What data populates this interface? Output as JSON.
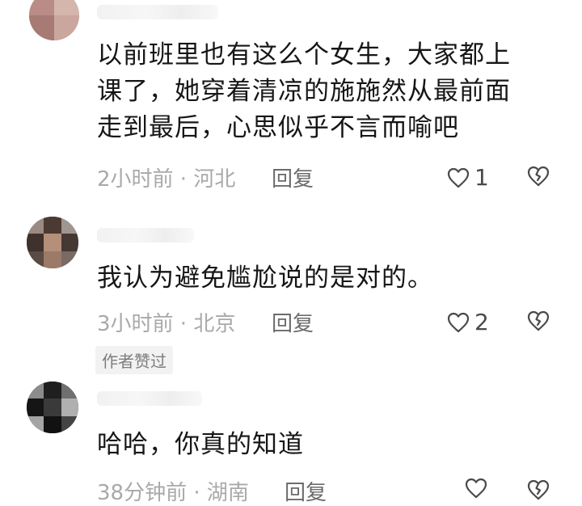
{
  "comments": [
    {
      "lines": [
        "以前班里也有这么个女生，大家都上",
        "课了，她穿着清凉的施施然从最前面",
        "走到最后，心思似乎不言而喻吧"
      ],
      "meta": "2小时前 · 河北",
      "reply_label": "回复",
      "like_count": "1"
    },
    {
      "lines": [
        "我认为避免尴尬说的是对的。"
      ],
      "meta": "3小时前 · 北京",
      "reply_label": "回复",
      "like_count": "2",
      "badge": "作者赞过"
    },
    {
      "lines": [
        "哈哈，你真的知道"
      ],
      "meta": "38分钟前 · 湖南",
      "reply_label": "回复",
      "like_count": ""
    }
  ],
  "icons": {
    "like": "heart-outline-icon",
    "dislike": "broken-heart-icon"
  }
}
